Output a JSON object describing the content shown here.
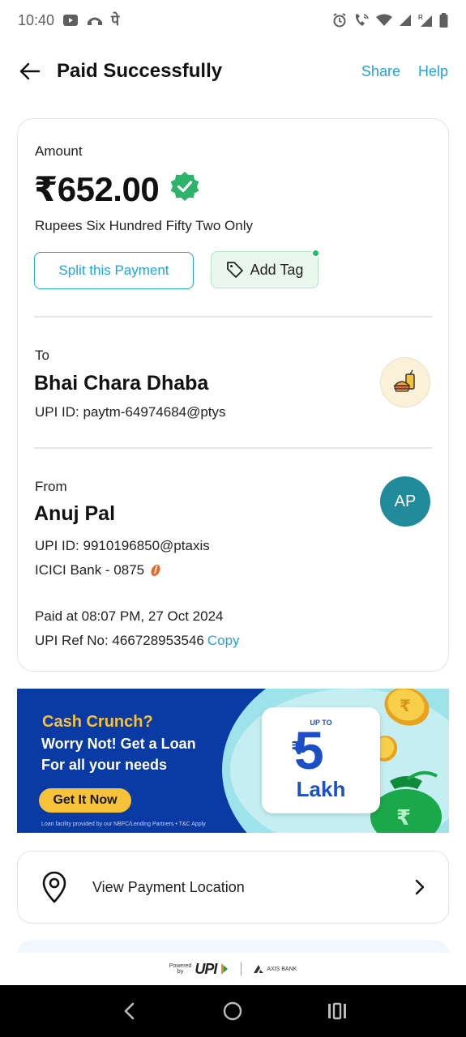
{
  "status_bar": {
    "time": "10:40",
    "app_glyph": "पे"
  },
  "header": {
    "title": "Paid Successfully",
    "share": "Share",
    "help": "Help"
  },
  "payment": {
    "amount_label": "Amount",
    "amount": "₹652.00",
    "amount_words": "Rupees Six Hundred Fifty Two Only",
    "split_button": "Split this Payment",
    "tag_button": "Add Tag",
    "verified_color": "#2db36a"
  },
  "recipient": {
    "label": "To",
    "name": "Bhai Chara Dhaba",
    "upi_id": "UPI ID: paytm-64974684@ptys"
  },
  "payer": {
    "label": "From",
    "name": "Anuj Pal",
    "initials": "AP",
    "upi_id": "UPI ID: 9910196850@ptaxis",
    "bank": "ICICI Bank - 0875"
  },
  "transaction": {
    "paid_at": "Paid at 08:07 PM, 27 Oct 2024",
    "ref_label": "UPI Ref No: 466728953546",
    "copy": "Copy"
  },
  "banner": {
    "title": "Cash Crunch?",
    "line1": "Worry Not! Get a Loan",
    "line2": "For all your needs",
    "cta": "Get It Now",
    "fine_print": "Loan facility provided by our NBFC/Lending Partners • T&C Apply",
    "upto": "UP TO",
    "rupee": "₹",
    "amount": "5",
    "unit": "Lakh"
  },
  "location": {
    "label": "View Payment Location"
  },
  "footer": {
    "powered_line1": "Powered",
    "powered_line2": "by",
    "upi": "UPI",
    "bank": "AXIS BANK"
  },
  "accent_color": "#1ea5dc"
}
